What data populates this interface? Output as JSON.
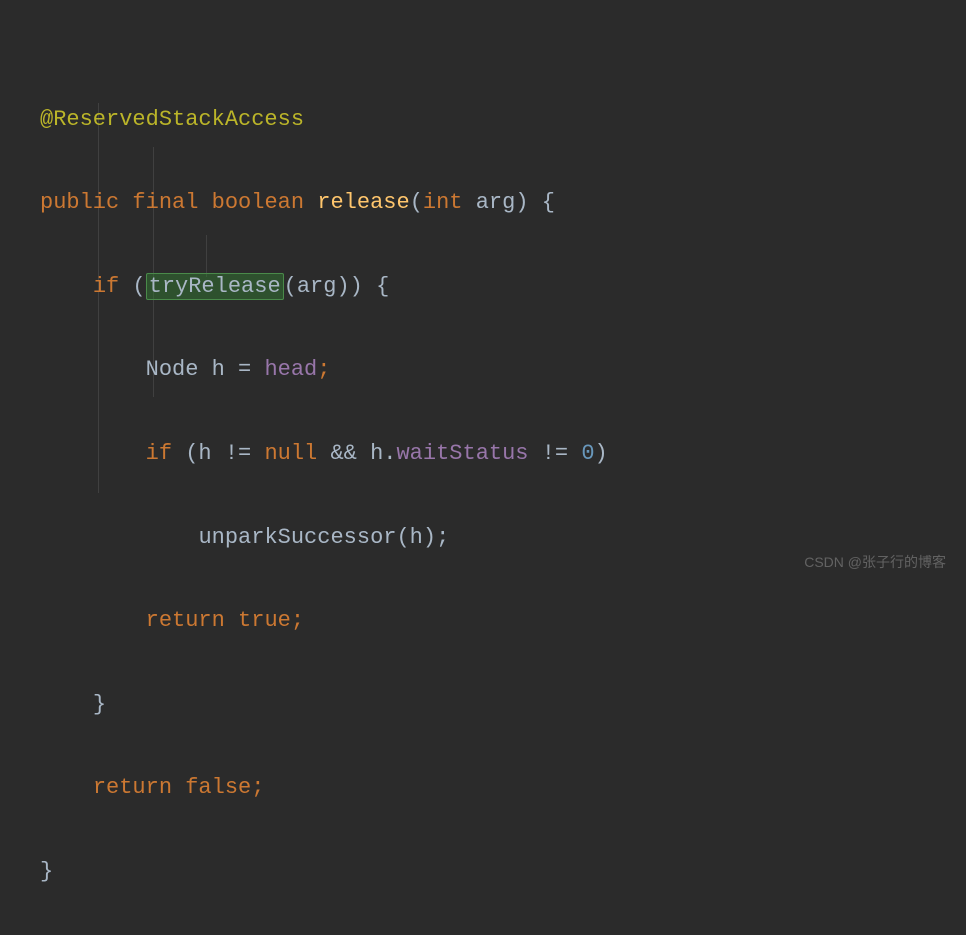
{
  "code": {
    "annotation": "@ReservedStackAccess",
    "kw_public": "public",
    "kw_final": "final",
    "kw_boolean": "boolean",
    "method_name": "release",
    "kw_int": "int",
    "param_arg": "arg",
    "open_brace": " {",
    "kw_if1": "if",
    "try_release": "tryRelease",
    "call_arg1": "(arg)) {",
    "node_type": "Node",
    "var_h": "h",
    "assign": " = ",
    "field_head": "head",
    "semicolon": ";",
    "kw_if2": "if",
    "cond_open": " (h != ",
    "kw_null": "null",
    "cond_and": " && h.",
    "field_waitStatus": "waitStatus",
    "cond_neq": " != ",
    "num_zero": "0",
    "cond_close": ")",
    "unpark_call": "unparkSuccessor(h);",
    "kw_return1": "return",
    "kw_true": "true",
    "close_brace1": "}",
    "kw_return2": "return",
    "kw_false": "false",
    "close_brace2": "}",
    "open_paren": "(",
    "close_paren_sig": ")",
    "space": " ",
    "open_paren_if": " ("
  },
  "watermark": "CSDN @张子行的博客"
}
